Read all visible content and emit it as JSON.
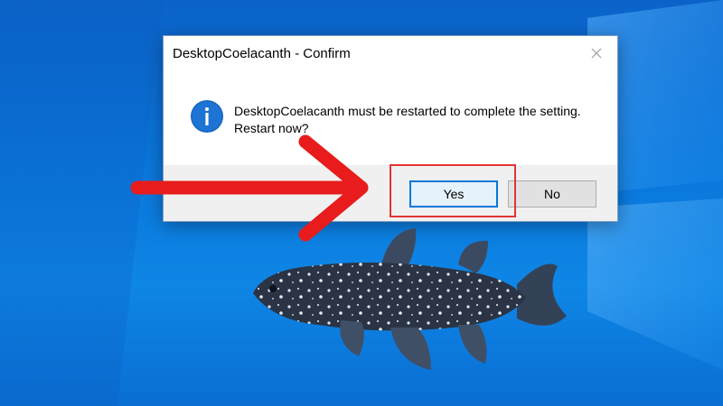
{
  "dialog": {
    "title": "DesktopCoelacanth - Confirm",
    "message_line1": "DesktopCoelacanth must be restarted to complete the setting.",
    "message_line2": "Restart now?",
    "icon": "info-icon",
    "close_icon": "close-icon",
    "buttons": {
      "yes_label": "Yes",
      "no_label": "No"
    }
  },
  "annotation": {
    "arrow": "arrow-right-icon",
    "arrow_color": "#e81c1c",
    "highlight_color": "#e23434",
    "highlight_target": "Yes"
  },
  "colors": {
    "desktop_blue": "#0a78dc",
    "accent": "#0078d7",
    "info_icon_blue": "#1565c0"
  }
}
